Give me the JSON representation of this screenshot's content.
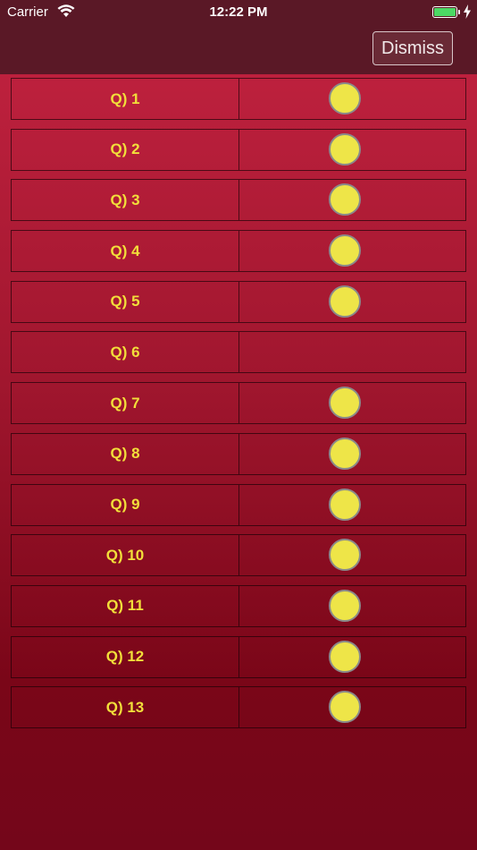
{
  "status": {
    "carrier": "Carrier",
    "time": "12:22 PM"
  },
  "toolbar": {
    "dismiss_label": "Dismiss"
  },
  "rows": [
    {
      "label": "Q) 1",
      "answered": true
    },
    {
      "label": "Q) 2",
      "answered": true
    },
    {
      "label": "Q) 3",
      "answered": true
    },
    {
      "label": "Q) 4",
      "answered": true
    },
    {
      "label": "Q) 5",
      "answered": true
    },
    {
      "label": "Q) 6",
      "answered": false
    },
    {
      "label": "Q) 7",
      "answered": true
    },
    {
      "label": "Q) 8",
      "answered": true
    },
    {
      "label": "Q) 9",
      "answered": true
    },
    {
      "label": "Q) 10",
      "answered": true
    },
    {
      "label": "Q) 11",
      "answered": true
    },
    {
      "label": "Q) 12",
      "answered": true
    },
    {
      "label": "Q) 13",
      "answered": true
    }
  ],
  "colors": {
    "label": "#f2df3a",
    "dot": "#eee548",
    "topbar": "#5a1826"
  }
}
